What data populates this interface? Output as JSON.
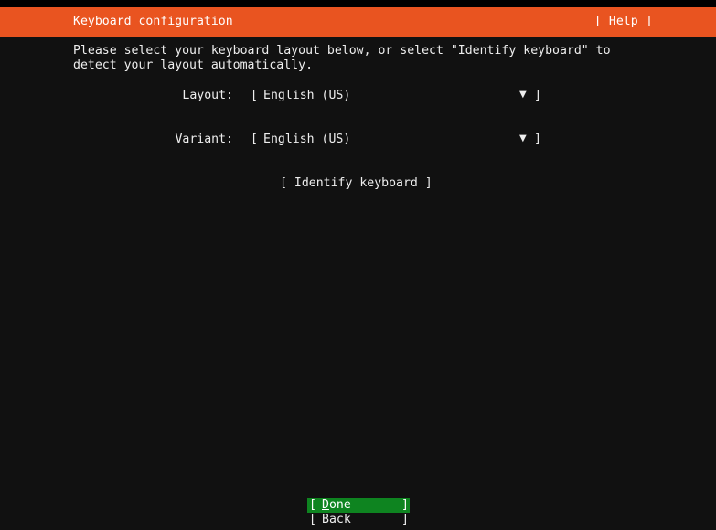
{
  "header": {
    "title": "Keyboard configuration",
    "help_label": "[ Help ]"
  },
  "intro": {
    "text": "Please select your keyboard layout below, or select \"Identify keyboard\" to\ndetect your layout automatically."
  },
  "form": {
    "layout": {
      "label": "Layout:",
      "value": "English (US)"
    },
    "variant": {
      "label": "Variant:",
      "value": "English (US)"
    }
  },
  "bracket_open": "[",
  "bracket_close": "]",
  "dropdown_arrow": "▼",
  "identify_label": "[ Identify keyboard ]",
  "buttons": {
    "done": {
      "mnemonic": "D",
      "rest": "one"
    },
    "back": {
      "label": "Back"
    }
  },
  "colors": {
    "header_bg": "#e95420",
    "background": "#111111",
    "done_bg": "#0e8420",
    "text": "#eeeeee"
  },
  "icons": {
    "dropdown": "caret-down-icon"
  }
}
